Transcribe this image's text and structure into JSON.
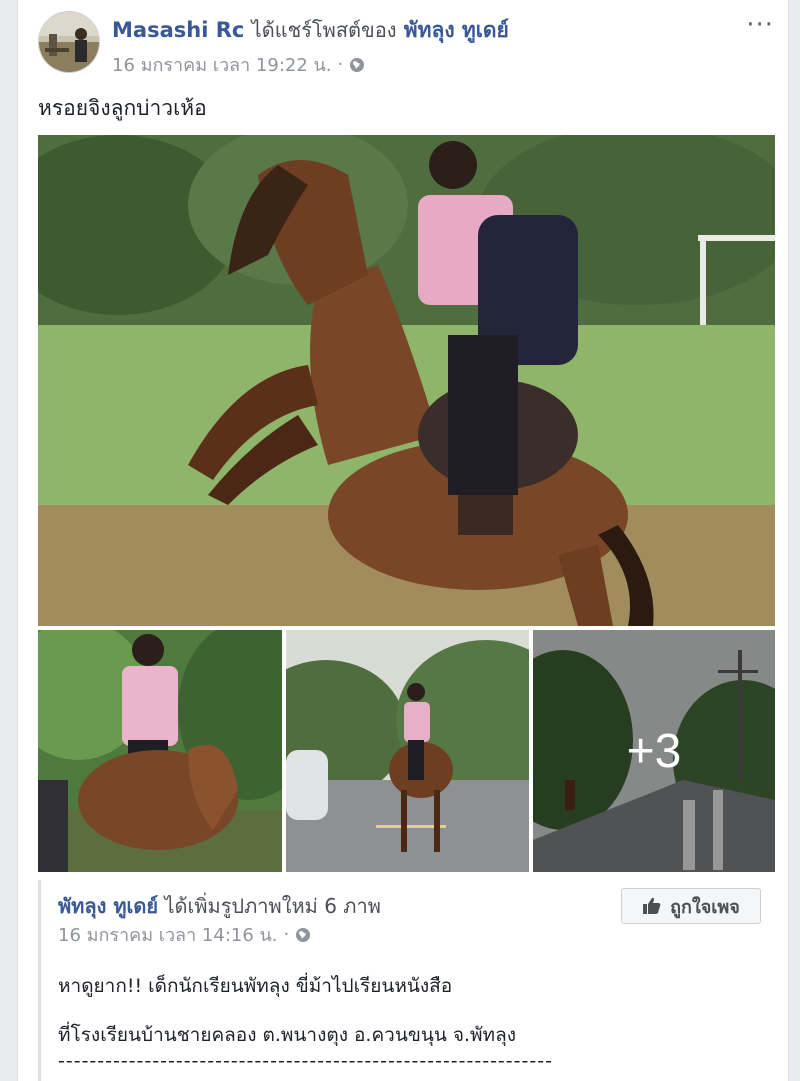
{
  "post": {
    "author": "Masashi Rc",
    "shared_text": "ได้แชร์โพสต์ของ",
    "shared_page": "พัทลุง ทูเดย์",
    "timestamp": "16 มกราคม เวลา 19:22 น.",
    "separator": "·",
    "audience_icon": "globe-icon",
    "more_icon": "more-options-icon",
    "more_text": "···",
    "caption": "หรอยจิงลูกบ่าวเห้อ"
  },
  "gallery": {
    "more_count": "+3"
  },
  "shared_post": {
    "page_name": "พัทลุง ทูเดย์",
    "action_text": "ได้เพิ่มรูปภาพใหม่ 6 ภาพ",
    "timestamp": "16 มกราคม เวลา 14:16 น.",
    "separator": "·",
    "like_button_label": "ถูกใจเพจ",
    "line1": "หาดูยาก!! เด็กนักเรียนพัทลุง ขี่ม้าไปเรียนหนังสือ",
    "line2": "ที่โรงเรียนบ้านชายคลอง ต.พนางตุง อ.ควนขนุน จ.พัทลุง",
    "line3": "---------------------------------------------------------------"
  },
  "colors": {
    "link": "#385898",
    "meta": "#90949c",
    "background": "#e9ebee"
  }
}
